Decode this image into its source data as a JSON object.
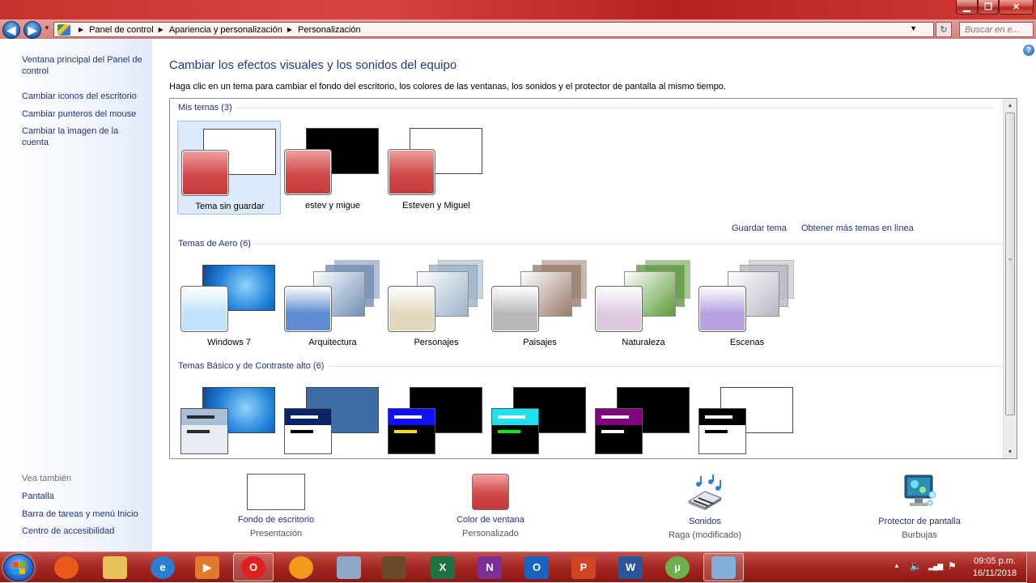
{
  "window": {
    "controls": {
      "minimize": "▁",
      "maximize": "❐",
      "close": "✕"
    }
  },
  "address_bar": {
    "crumbs": [
      "Panel de control",
      "Apariencia y personalización",
      "Personalización"
    ],
    "search_placeholder": "Buscar en e...",
    "back_glyph": "◀",
    "forward_glyph": "▶",
    "dropdown_glyph": "▼",
    "refresh_glyph": "↻",
    "recent_glyph": "▼",
    "separator_glyph": "▶"
  },
  "sidebar": {
    "links": [
      "Ventana principal del Panel de control",
      "Cambiar iconos del escritorio",
      "Cambiar punteros del mouse",
      "Cambiar la imagen de la cuenta"
    ],
    "see_also_title": "Vea también",
    "see_also": [
      "Pantalla",
      "Barra de tareas y menú Inicio",
      "Centro de accesibilidad"
    ]
  },
  "main": {
    "help_glyph": "?",
    "title": "Cambiar los efectos visuales y los sonidos del equipo",
    "description": "Haga clic en un tema para cambiar el fondo del escritorio, los colores de las ventanas, los sonidos y el protector de pantalla al mismo tiempo.",
    "my_themes": {
      "header": "Mis temas (3)",
      "items": [
        {
          "label": "Tema sin guardar",
          "bg": "#ffffff",
          "selected": true
        },
        {
          "label": "estev y migue",
          "bg": "#000000",
          "selected": false
        },
        {
          "label": "Esteven y Miguel",
          "bg": "#ffffff",
          "selected": false
        }
      ],
      "save_link": "Guardar tema",
      "online_link": "Obtener más temas en línea"
    },
    "aero_themes": {
      "header": "Temas de Aero (6)",
      "items": [
        {
          "label": "Windows 7",
          "bg": "#1f7fd6",
          "swatch": "#bfe3fb"
        },
        {
          "label": "Arquitectura",
          "bg": "#6e8fb8",
          "swatch": "#5f8bd0"
        },
        {
          "label": "Personajes",
          "bg": "#9bb3c9",
          "swatch": "#e2d9bd"
        },
        {
          "label": "Paisajes",
          "bg": "#9a7b6a",
          "swatch": "#b9b9b9"
        },
        {
          "label": "Naturaleza",
          "bg": "#5c9a3a",
          "swatch": "#ddc9df"
        },
        {
          "label": "Escenas",
          "bg": "#b8b8c4",
          "swatch": "#b7a1e0"
        }
      ]
    },
    "basic_themes": {
      "header": "Temas Básico y de Contraste alto (6)",
      "items": [
        {
          "bg": "#1f7fd6",
          "title": "#a9bed8",
          "win": "#e8edf3",
          "bar1": "#2b2b2b",
          "bar2": "#2b2b2b"
        },
        {
          "bg": "#3a6ea5",
          "title": "#0a246a",
          "win": "#ffffff",
          "bar1": "#ffffff",
          "bar2": "#000000"
        },
        {
          "bg": "#000000",
          "title": "#1010ff",
          "win": "#000000",
          "bar1": "#ffffff",
          "bar2": "#ffd800"
        },
        {
          "bg": "#000000",
          "title": "#1ee2ee",
          "win": "#000000",
          "bar1": "#ffffff",
          "bar2": "#00ee00"
        },
        {
          "bg": "#000000",
          "title": "#800080",
          "win": "#000000",
          "bar1": "#ffffff",
          "bar2": "#ffffff"
        },
        {
          "bg": "#ffffff",
          "title": "#000000",
          "win": "#ffffff",
          "bar1": "#ffffff",
          "bar2": "#000000"
        }
      ]
    },
    "options": [
      {
        "label": "Fondo de escritorio",
        "value": "Presentación",
        "icon": "white-rectangle"
      },
      {
        "label": "Color de ventana",
        "value": "Personalizado",
        "icon": "red-swatch"
      },
      {
        "label": "Sonidos",
        "value": "Raga (modificado)",
        "icon": "music-keyboard"
      },
      {
        "label": "Protector de pantalla",
        "value": "Burbujas",
        "icon": "monitor-bubbles"
      }
    ]
  },
  "taskbar": {
    "apps": [
      {
        "name": "firefox",
        "glyph": "",
        "color": "#e8591a"
      },
      {
        "name": "explorer",
        "glyph": "",
        "color": "#e8c25a"
      },
      {
        "name": "internet-explorer",
        "glyph": "e",
        "color": "#2a7fd4"
      },
      {
        "name": "media",
        "glyph": "▶",
        "color": "#e07a2a"
      },
      {
        "name": "opera",
        "glyph": "O",
        "color": "#e0201e"
      },
      {
        "name": "bubble-app",
        "glyph": "",
        "color": "#f19a1c"
      },
      {
        "name": "calculator",
        "glyph": "",
        "color": "#8ea9c6"
      },
      {
        "name": "character",
        "glyph": "",
        "color": "#6b4a2a"
      },
      {
        "name": "excel",
        "glyph": "X",
        "color": "#1f7244"
      },
      {
        "name": "onenote",
        "glyph": "N",
        "color": "#7b2f97"
      },
      {
        "name": "outlook",
        "glyph": "O",
        "color": "#1565c0"
      },
      {
        "name": "powerpoint",
        "glyph": "P",
        "color": "#d04423"
      },
      {
        "name": "word",
        "glyph": "W",
        "color": "#2b579a"
      },
      {
        "name": "utorrent",
        "glyph": "µ",
        "color": "#6ab04c"
      },
      {
        "name": "control-panel",
        "glyph": "",
        "color": "#7fb0d9"
      }
    ],
    "tray_glyphs": {
      "arrow": "▲",
      "volume": "🔈",
      "signal": "▂▄▆",
      "flag": "⚑"
    },
    "time": "09:05 p.m.",
    "date": "16/11/2018"
  }
}
